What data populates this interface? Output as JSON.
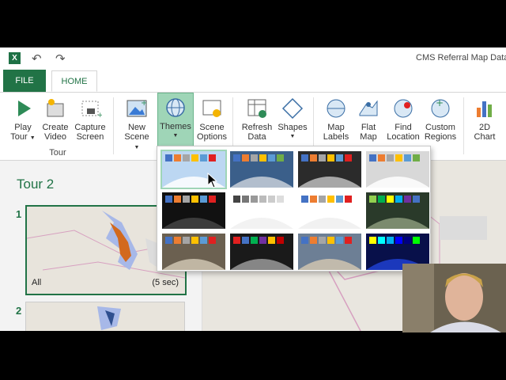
{
  "window": {
    "app_icon": "excel-icon",
    "doc_title": "CMS Referral Map Data",
    "undo_icon": "undo-icon",
    "redo_icon": "redo-icon"
  },
  "tabs": {
    "file": "FILE",
    "home": "HOME"
  },
  "ribbon": {
    "play_tour": {
      "line1": "Play",
      "line2": "Tour"
    },
    "create_video": {
      "line1": "Create",
      "line2": "Video"
    },
    "capture_screen": {
      "line1": "Capture",
      "line2": "Screen"
    },
    "group_tour": "Tour",
    "new_scene": {
      "line1": "New",
      "line2": "Scene"
    },
    "themes": {
      "line1": "Themes"
    },
    "scene_options": {
      "line1": "Scene",
      "line2": "Options"
    },
    "refresh_data": {
      "line1": "Refresh",
      "line2": "Data"
    },
    "shapes": {
      "line1": "Shapes"
    },
    "map_labels": {
      "line1": "Map",
      "line2": "Labels"
    },
    "flat_map": {
      "line1": "Flat",
      "line2": "Map"
    },
    "find_location": {
      "line1": "Find",
      "line2": "Location"
    },
    "custom_regions": {
      "line1": "Custom",
      "line2": "Regions"
    },
    "chart_2d": {
      "line1": "2D",
      "line2": "Chart"
    }
  },
  "tour_pane": {
    "title": "Tour 2",
    "scenes": [
      {
        "number": "1",
        "name": "All",
        "duration": "(5 sec)"
      },
      {
        "number": "2"
      }
    ]
  },
  "themes_gallery": {
    "themes": [
      {
        "swatches": [
          "#4472c4",
          "#ed7d31",
          "#a5a5a5",
          "#ffc000",
          "#5b9bd5",
          "#e02020"
        ],
        "globe": "light-blue"
      },
      {
        "swatches": [
          "#4472c4",
          "#ed7d31",
          "#a5a5a5",
          "#ffc000",
          "#5b9bd5",
          "#70ad47"
        ],
        "globe": "earth-photo"
      },
      {
        "swatches": [
          "#4472c4",
          "#ed7d31",
          "#a5a5a5",
          "#ffc000",
          "#5b9bd5",
          "#e02020"
        ],
        "globe": "earth-gray"
      },
      {
        "swatches": [
          "#4472c4",
          "#ed7d31",
          "#a5a5a5",
          "#ffc000",
          "#5b9bd5",
          "#70ad47"
        ],
        "globe": "light-gray"
      },
      {
        "swatches": [
          "#4472c4",
          "#ed7d31",
          "#a5a5a5",
          "#ffc000",
          "#5b9bd5",
          "#e02020"
        ],
        "globe": "dark"
      },
      {
        "swatches": [
          "#444444",
          "#777777",
          "#999999",
          "#bbbbbb",
          "#cccccc",
          "#dddddd"
        ],
        "globe": "white"
      },
      {
        "swatches": [
          "#4472c4",
          "#ed7d31",
          "#a5a5a5",
          "#ffc000",
          "#5b9bd5",
          "#e02020"
        ],
        "globe": "white-2"
      },
      {
        "swatches": [
          "#92d050",
          "#00b050",
          "#ffff00",
          "#00b0f0",
          "#7030a0",
          "#4472c4"
        ],
        "globe": "earth-green"
      },
      {
        "swatches": [
          "#4472c4",
          "#ed7d31",
          "#a5a5a5",
          "#ffc000",
          "#5b9bd5",
          "#e02020"
        ],
        "globe": "tan"
      },
      {
        "swatches": [
          "#e02020",
          "#4472c4",
          "#00b050",
          "#7030a0",
          "#ffc000",
          "#c00000"
        ],
        "globe": "dark-2"
      },
      {
        "swatches": [
          "#4472c4",
          "#ed7d31",
          "#a5a5a5",
          "#ffc000",
          "#5b9bd5",
          "#e02020"
        ],
        "globe": "dusty"
      },
      {
        "swatches": [
          "#ffff00",
          "#00ffff",
          "#00b0f0",
          "#0000ff",
          "#000080",
          "#00ff00"
        ],
        "globe": "blue-night"
      }
    ]
  }
}
